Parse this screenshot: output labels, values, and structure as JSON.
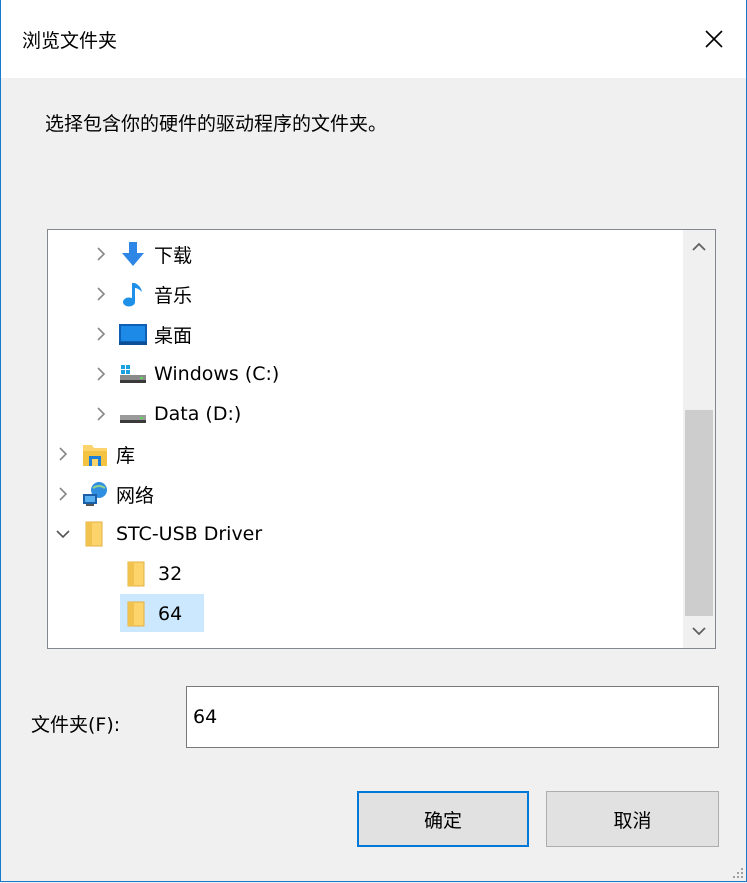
{
  "dialog": {
    "title": "浏览文件夹",
    "instruction": "选择包含你的硬件的驱动程序的文件夹。"
  },
  "tree": {
    "items": [
      {
        "label": "下载",
        "icon": "downloads-arrow-icon",
        "chevron": "collapsed",
        "level": 1
      },
      {
        "label": "音乐",
        "icon": "music-note-icon",
        "chevron": "collapsed",
        "level": 1
      },
      {
        "label": "桌面",
        "icon": "desktop-icon",
        "chevron": "collapsed",
        "level": 1
      },
      {
        "label": "Windows (C:)",
        "icon": "windows-drive-icon",
        "chevron": "collapsed",
        "level": 1
      },
      {
        "label": "Data (D:)",
        "icon": "drive-icon",
        "chevron": "collapsed",
        "level": 1
      },
      {
        "label": "库",
        "icon": "library-icon",
        "chevron": "collapsed",
        "level": 0
      },
      {
        "label": "网络",
        "icon": "network-icon",
        "chevron": "collapsed",
        "level": 0
      },
      {
        "label": "STC-USB Driver",
        "icon": "folder-icon",
        "chevron": "expanded",
        "level": 0
      },
      {
        "label": "32",
        "icon": "folder-icon",
        "chevron": "none",
        "level": 1
      },
      {
        "label": "64",
        "icon": "folder-icon",
        "chevron": "none",
        "level": 1,
        "selected": true
      }
    ]
  },
  "folder_field": {
    "label": "文件夹(F):",
    "value": "64"
  },
  "buttons": {
    "ok": "确定",
    "cancel": "取消"
  },
  "colors": {
    "accent": "#0078d7",
    "selection": "#cce8ff",
    "folder": "#fcd46b"
  }
}
